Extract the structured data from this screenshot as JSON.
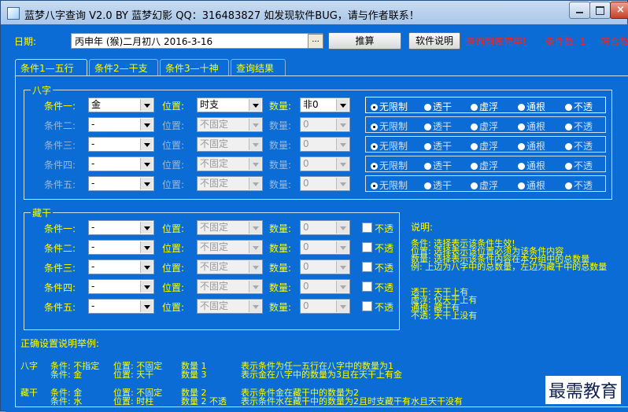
{
  "title": "蓝梦八字查询 V2.0 BY 蓝梦幻影 QQ：316483827 如发现软件BUG，请与作者联系！",
  "top": {
    "date_label": "日期:",
    "date_value": "丙申年 (猴)二月初八  2016-3-16",
    "dots": "...",
    "calc_button": "推算",
    "help_button": "软件说明",
    "status": "查询列表完毕!",
    "condition_count": "条件数: 1",
    "match_count": "符合数"
  },
  "tabs": [
    "条件1—五行",
    "条件2—干支",
    "条件3—十神",
    "查询结果"
  ],
  "bazi": {
    "title": "八字",
    "pos_label": "位置:",
    "qty_label": "数量:",
    "radio_labels": [
      "无限制",
      "透干",
      "虚浮",
      "通根",
      "不透"
    ],
    "rows": [
      {
        "label": "条件一:",
        "element": "金",
        "position": "时支",
        "qty": "非0"
      },
      {
        "label": "条件二:",
        "element": "-",
        "position": "不固定",
        "qty": "0"
      },
      {
        "label": "条件三:",
        "element": "-",
        "position": "不固定",
        "qty": "0"
      },
      {
        "label": "条件四:",
        "element": "-",
        "position": "不固定",
        "qty": "0"
      },
      {
        "label": "条件五:",
        "element": "-",
        "position": "不固定",
        "qty": "0"
      }
    ]
  },
  "canggan": {
    "title": "藏干",
    "pos_label": "位置:",
    "qty_label": "数量:",
    "notrans": "不透",
    "rows": [
      {
        "label": "条件一:",
        "element": "-",
        "position": "不固定",
        "qty": "0"
      },
      {
        "label": "条件二:",
        "element": "-",
        "position": "不固定",
        "qty": "0"
      },
      {
        "label": "条件三:",
        "element": "-",
        "position": "不固定",
        "qty": "0"
      },
      {
        "label": "条件四:",
        "element": "-",
        "position": "不固定",
        "qty": "0"
      },
      {
        "label": "条件五:",
        "element": "-",
        "position": "不固定",
        "qty": "0"
      }
    ]
  },
  "notes": {
    "heading": "说明:",
    "lines": [
      "条件: 选择表示该条件生效!",
      "位置: 选择表示该位置必须为该条件内容",
      "数量: 选择表示该条件内容在本分组中的总数量",
      "例: 上边为八字中的总数量，左边为藏干中的总数量"
    ],
    "legend": [
      "透干: 天干上有",
      "虚浮: 仅天干上有",
      "通根: 藏干有",
      "不透: 天干上没有"
    ]
  },
  "examples": {
    "heading": "正确设置说明举例:",
    "rows": [
      {
        "a": "八字",
        "b": "条件: 不指定",
        "c": "位置: 不固定",
        "d": "数量 1",
        "e": "表示条件为任一五行在八字中的数量为1"
      },
      {
        "a": "",
        "b": "条件: 金",
        "c": "位置: 天干",
        "d": "数量 3",
        "e": "表示金在八字中的数量为3且在天干上有金"
      },
      {
        "a": "藏干",
        "b": "条件: 金",
        "c": "位置: 不固定",
        "d": "数量 2",
        "e": "表示条件金在藏干中的数量为2"
      },
      {
        "a": "",
        "b": "条件: 水",
        "c": "位置: 时柱",
        "d": "数量 2 不透",
        "e": "表示条件水在藏干中的数量为2且时支藏干有水且天干没有"
      }
    ]
  },
  "watermark": "最需教育"
}
